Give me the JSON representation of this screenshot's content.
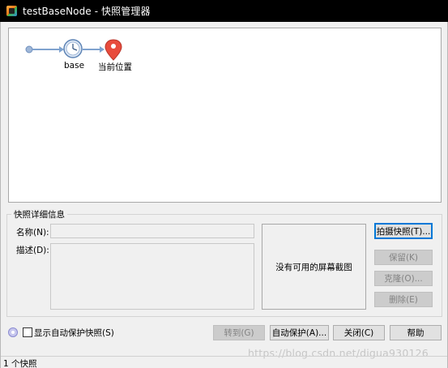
{
  "window": {
    "title": "testBaseNode - 快照管理器"
  },
  "tree": {
    "nodes": [
      {
        "label": "base",
        "icon": "clock-icon"
      },
      {
        "label": "当前位置",
        "icon": "location-pin-icon"
      }
    ]
  },
  "details": {
    "group_title": "快照详细信息",
    "name_label": "名称(N):",
    "name_value": "",
    "description_label": "描述(D):",
    "description_value": "",
    "no_screenshot_text": "没有可用的屏幕截图"
  },
  "side_buttons": {
    "take_snapshot": "拍摄快照(T)...",
    "keep": "保留(K)",
    "clone": "克隆(O)...",
    "delete": "删除(E)"
  },
  "bottom": {
    "show_autoprotect_label": "显示自动保护快照(S)",
    "show_autoprotect_checked": false,
    "goto": "转到(G)",
    "autoprotect": "自动保护(A)...",
    "close": "关闭(C)",
    "help": "帮助"
  },
  "status": {
    "text": "1 个快照"
  },
  "watermark": {
    "text": "https://blog.csdn.net/digua930126"
  },
  "colors": {
    "titlebar": "#000000",
    "accent_blue": "#0078d7",
    "pin_red": "#e84c3d",
    "connector": "#7fa3cf"
  }
}
